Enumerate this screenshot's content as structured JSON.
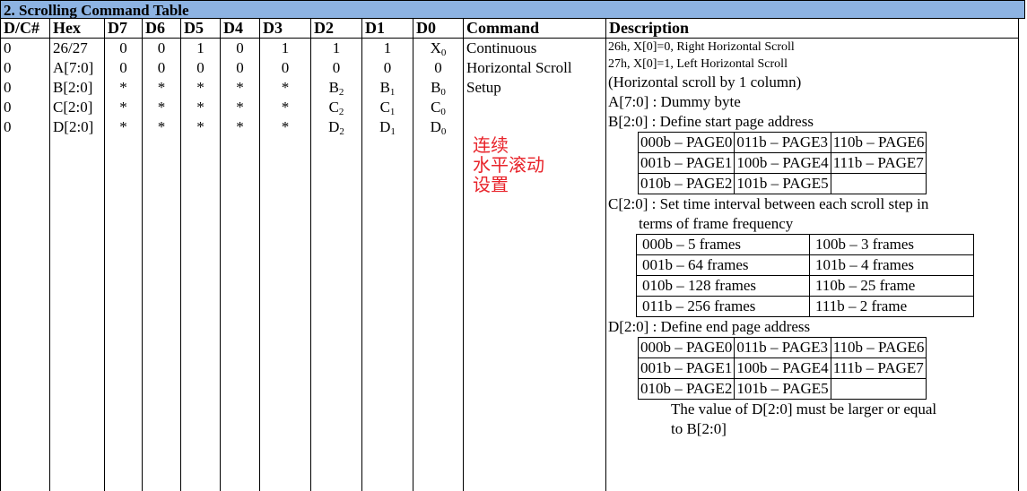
{
  "title": "2. Scrolling Command Table",
  "headers": [
    "D/C#",
    "Hex",
    "D7",
    "D6",
    "D5",
    "D4",
    "D3",
    "D2",
    "D1",
    "D0",
    "Command",
    "Description"
  ],
  "rows": [
    {
      "dc": "0",
      "hex": "26/27",
      "d7": "0",
      "d6": "0",
      "d5": "1",
      "d4": "0",
      "d3": "1",
      "d2": "1",
      "d1": "1",
      "d0": "X",
      "d0sub": "0"
    },
    {
      "dc": "0",
      "hex": "A[7:0]",
      "d7": "0",
      "d6": "0",
      "d5": "0",
      "d4": "0",
      "d3": "0",
      "d2": "0",
      "d1": "0",
      "d0": "0",
      "d0sub": ""
    },
    {
      "dc": "0",
      "hex": "B[2:0]",
      "d7": "*",
      "d6": "*",
      "d5": "*",
      "d4": "*",
      "d3": "*",
      "d2": "B",
      "d2sub": "2",
      "d1": "B",
      "d1sub": "1",
      "d0": "B",
      "d0sub": "0"
    },
    {
      "dc": "0",
      "hex": "C[2:0]",
      "d7": "*",
      "d6": "*",
      "d5": "*",
      "d4": "*",
      "d3": "*",
      "d2": "C",
      "d2sub": "2",
      "d1": "C",
      "d1sub": "1",
      "d0": "C",
      "d0sub": "0"
    },
    {
      "dc": "0",
      "hex": "D[2:0]",
      "d7": "*",
      "d6": "*",
      "d5": "*",
      "d4": "*",
      "d3": "*",
      "d2": "D",
      "d2sub": "2",
      "d1": "D",
      "d1sub": "1",
      "d0": "D",
      "d0sub": "0"
    }
  ],
  "command": {
    "lines": [
      "Continuous",
      "Horizontal Scroll",
      "Setup"
    ],
    "chinese_lines": [
      "连续",
      "水平滚动",
      "设置"
    ]
  },
  "description": {
    "l1": "26h, X[0]=0, Right Horizontal Scroll",
    "l2": "27h, X[0]=1, Left Horizontal Scroll",
    "l3": "(Horizontal scroll by 1 column)",
    "l4": "A[7:0] : Dummy byte",
    "l5": "B[2:0] : Define start page address",
    "page_table": [
      [
        "000b – PAGE0",
        "011b – PAGE3",
        "110b – PAGE6"
      ],
      [
        "001b – PAGE1",
        "100b – PAGE4",
        "111b – PAGE7"
      ],
      [
        "010b – PAGE2",
        "101b – PAGE5",
        ""
      ]
    ],
    "l6": "C[2:0] : Set time interval between each scroll step in",
    "l7": "terms of  frame frequency",
    "frame_table": [
      [
        "000b – 5 frames",
        "100b – 3 frames"
      ],
      [
        "001b – 64 frames",
        "101b – 4 frames"
      ],
      [
        "010b – 128 frames",
        "110b – 25 frame"
      ],
      [
        "011b – 256 frames",
        "111b – 2 frame"
      ]
    ],
    "l8": "D[2:0] : Define end page address",
    "l9": "The value of D[2:0] must be larger or equal",
    "l10": "to B[2:0]"
  }
}
